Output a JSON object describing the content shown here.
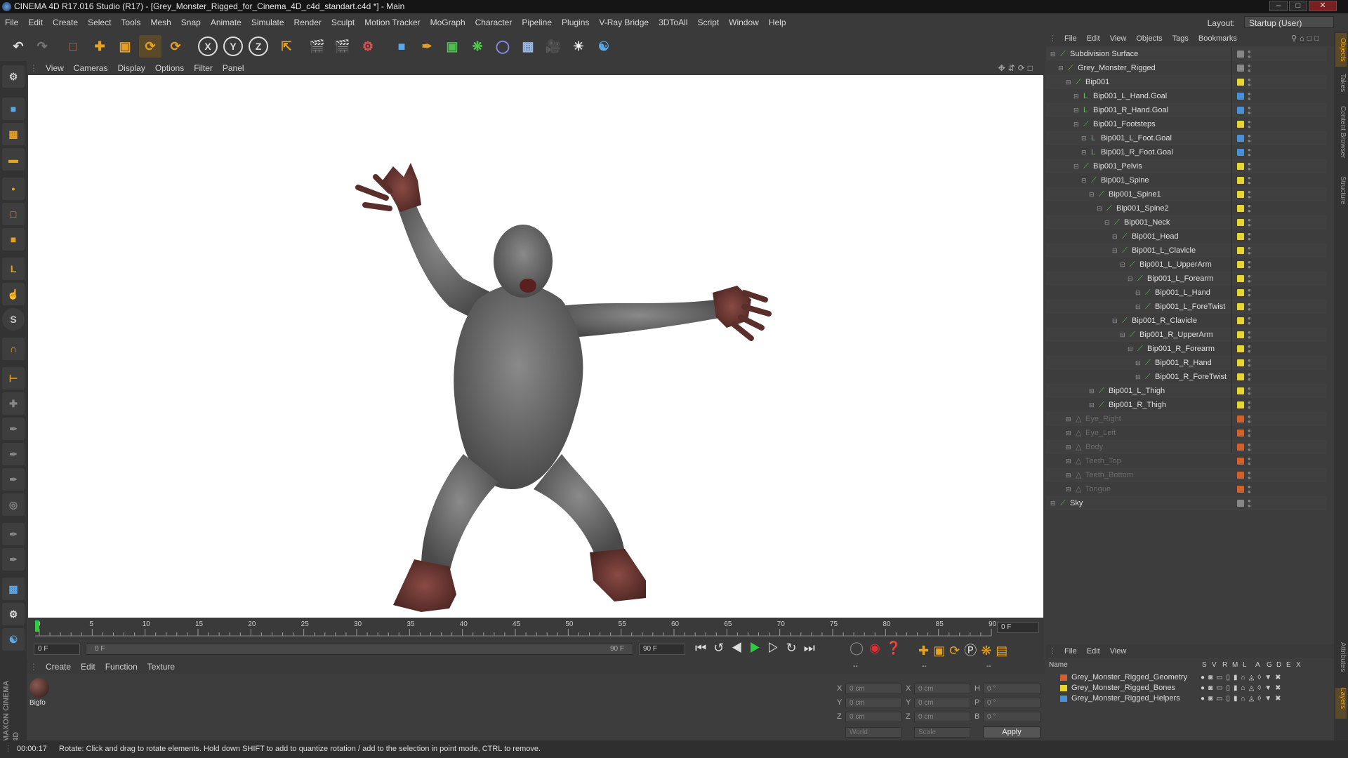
{
  "window": {
    "title": "CINEMA 4D R17.016 Studio (R17) - [Grey_Monster_Rigged_for_Cinema_4D_c4d_standart.c4d *] - Main"
  },
  "menu": [
    "File",
    "Edit",
    "Create",
    "Select",
    "Tools",
    "Mesh",
    "Snap",
    "Animate",
    "Simulate",
    "Render",
    "Sculpt",
    "Motion Tracker",
    "MoGraph",
    "Character",
    "Pipeline",
    "Plugins",
    "V-Ray Bridge",
    "3DToAll",
    "Script",
    "Window",
    "Help"
  ],
  "layout": {
    "label": "Layout:",
    "value": "Startup (User)"
  },
  "viewport": {
    "menu": [
      "View",
      "Cameras",
      "Display",
      "Options",
      "Filter",
      "Panel"
    ]
  },
  "timeline": {
    "ticks": [
      "0",
      "5",
      "10",
      "15",
      "20",
      "25",
      "30",
      "35",
      "40",
      "45",
      "50",
      "55",
      "60",
      "65",
      "70",
      "75",
      "80",
      "85",
      "90"
    ],
    "frame_field": "0 F"
  },
  "transport": {
    "start": "0 F",
    "range_start": "0 F",
    "range_end": "90 F",
    "end": "90 F"
  },
  "materials": {
    "menu": [
      "Create",
      "Edit",
      "Function",
      "Texture"
    ],
    "item": "Bigfo"
  },
  "coords": {
    "headers": [
      "--",
      "--",
      "--"
    ],
    "x_pos": "0 cm",
    "y_pos": "0 cm",
    "z_pos": "0 cm",
    "x_size": "0 cm",
    "y_size": "0 cm",
    "z_size": "0 cm",
    "h": "0 °",
    "p": "0 °",
    "b": "0 °",
    "labels": {
      "x": "X",
      "y": "Y",
      "z": "Z",
      "h": "H",
      "p": "P",
      "b": "B"
    },
    "world": "World",
    "scale": "Scale",
    "apply": "Apply"
  },
  "objects": {
    "menu": [
      "File",
      "Edit",
      "View",
      "Objects",
      "Tags",
      "Bookmarks"
    ],
    "rows": [
      {
        "name": "Subdivision Surface",
        "depth": 0,
        "color": "#888888",
        "dim": false
      },
      {
        "name": "Grey_Monster_Rigged",
        "depth": 1,
        "color": "#888888",
        "dim": false
      },
      {
        "name": "Bip001",
        "depth": 2,
        "color": "#e8d630",
        "dim": false
      },
      {
        "name": "Bip001_L_Hand.Goal",
        "depth": 3,
        "color": "#4a8fd8",
        "dim": false
      },
      {
        "name": "Bip001_R_Hand.Goal",
        "depth": 3,
        "color": "#4a8fd8",
        "dim": false
      },
      {
        "name": "Bip001_Footsteps",
        "depth": 3,
        "color": "#e8d630",
        "dim": false
      },
      {
        "name": "Bip001_L_Foot.Goal",
        "depth": 4,
        "color": "#4a8fd8",
        "dim": false
      },
      {
        "name": "Bip001_R_Foot.Goal",
        "depth": 4,
        "color": "#4a8fd8",
        "dim": false
      },
      {
        "name": "Bip001_Pelvis",
        "depth": 3,
        "color": "#e8d630",
        "dim": false
      },
      {
        "name": "Bip001_Spine",
        "depth": 4,
        "color": "#e8d630",
        "dim": false
      },
      {
        "name": "Bip001_Spine1",
        "depth": 5,
        "color": "#e8d630",
        "dim": false
      },
      {
        "name": "Bip001_Spine2",
        "depth": 6,
        "color": "#e8d630",
        "dim": false
      },
      {
        "name": "Bip001_Neck",
        "depth": 7,
        "color": "#e8d630",
        "dim": false
      },
      {
        "name": "Bip001_Head",
        "depth": 8,
        "color": "#e8d630",
        "dim": false
      },
      {
        "name": "Bip001_L_Clavicle",
        "depth": 8,
        "color": "#e8d630",
        "dim": false
      },
      {
        "name": "Bip001_L_UpperArm",
        "depth": 9,
        "color": "#e8d630",
        "dim": false
      },
      {
        "name": "Bip001_L_Forearm",
        "depth": 10,
        "color": "#e8d630",
        "dim": false
      },
      {
        "name": "Bip001_L_Hand",
        "depth": 11,
        "color": "#e8d630",
        "dim": false
      },
      {
        "name": "Bip001_L_ForeTwist",
        "depth": 11,
        "color": "#e8d630",
        "dim": false
      },
      {
        "name": "Bip001_R_Clavicle",
        "depth": 8,
        "color": "#e8d630",
        "dim": false
      },
      {
        "name": "Bip001_R_UpperArm",
        "depth": 9,
        "color": "#e8d630",
        "dim": false
      },
      {
        "name": "Bip001_R_Forearm",
        "depth": 10,
        "color": "#e8d630",
        "dim": false
      },
      {
        "name": "Bip001_R_Hand",
        "depth": 11,
        "color": "#e8d630",
        "dim": false
      },
      {
        "name": "Bip001_R_ForeTwist",
        "depth": 11,
        "color": "#e8d630",
        "dim": false
      },
      {
        "name": "Bip001_L_Thigh",
        "depth": 5,
        "color": "#e8d630",
        "dim": false
      },
      {
        "name": "Bip001_R_Thigh",
        "depth": 5,
        "color": "#e8d630",
        "dim": false
      },
      {
        "name": "Eye_Right",
        "depth": 2,
        "color": "#d2602a",
        "dim": true
      },
      {
        "name": "Eye_Left",
        "depth": 2,
        "color": "#d2602a",
        "dim": true
      },
      {
        "name": "Body",
        "depth": 2,
        "color": "#d2602a",
        "dim": true
      },
      {
        "name": "Teeth_Top",
        "depth": 2,
        "color": "#d2602a",
        "dim": true
      },
      {
        "name": "Teeth_Bottom",
        "depth": 2,
        "color": "#d2602a",
        "dim": true
      },
      {
        "name": "Tongue",
        "depth": 2,
        "color": "#d2602a",
        "dim": true
      },
      {
        "name": "Sky",
        "depth": 0,
        "color": "#888888",
        "dim": false
      }
    ]
  },
  "layers": {
    "menu": [
      "File",
      "Edit",
      "View"
    ],
    "headers": [
      "Name",
      "S",
      "V",
      "R",
      "M",
      "L",
      "A",
      "G",
      "D",
      "E",
      "X"
    ],
    "rows": [
      {
        "name": "Grey_Monster_Rigged_Geometry",
        "color": "#d2602a"
      },
      {
        "name": "Grey_Monster_Rigged_Bones",
        "color": "#e8d630"
      },
      {
        "name": "Grey_Monster_Rigged_Helpers",
        "color": "#4a8fd8"
      }
    ]
  },
  "right_tabs": [
    "Objects",
    "Takes",
    "Content Browser",
    "Structure",
    "Attributes",
    "Layers"
  ],
  "status": {
    "time": "00:00:17",
    "text": "Rotate: Click and drag to rotate elements. Hold down SHIFT to add to quantize rotation / add to the selection in point mode, CTRL to remove."
  },
  "brand": {
    "line1": "MAXON",
    "line2": "CINEMA 4D"
  }
}
